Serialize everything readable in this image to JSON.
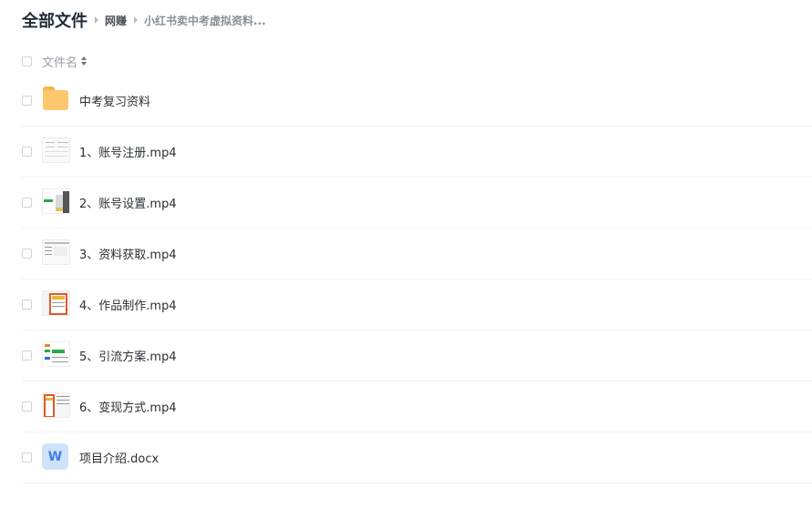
{
  "breadcrumb": {
    "root": "全部文件",
    "level1": "网赚",
    "level2": "小红书卖中考虚拟资料..."
  },
  "list_header": {
    "name_label": "文件名"
  },
  "files": [
    {
      "name": "中考复习资料",
      "icon": "folder-icon"
    },
    {
      "name": "1、账号注册.mp4",
      "icon": "video-thumbnail"
    },
    {
      "name": "2、账号设置.mp4",
      "icon": "video-thumbnail"
    },
    {
      "name": "3、资料获取.mp4",
      "icon": "video-thumbnail"
    },
    {
      "name": "4、作品制作.mp4",
      "icon": "video-thumbnail"
    },
    {
      "name": "5、引流方案.mp4",
      "icon": "video-thumbnail"
    },
    {
      "name": "6、变现方式.mp4",
      "icon": "video-thumbnail"
    },
    {
      "name": "项目介绍.docx",
      "icon": "word-doc-icon",
      "icon_letter": "W"
    }
  ],
  "colors": {
    "folder": "#fcc86b",
    "doc_bg": "#cfe2fb",
    "doc_letter": "#3d7de8"
  }
}
